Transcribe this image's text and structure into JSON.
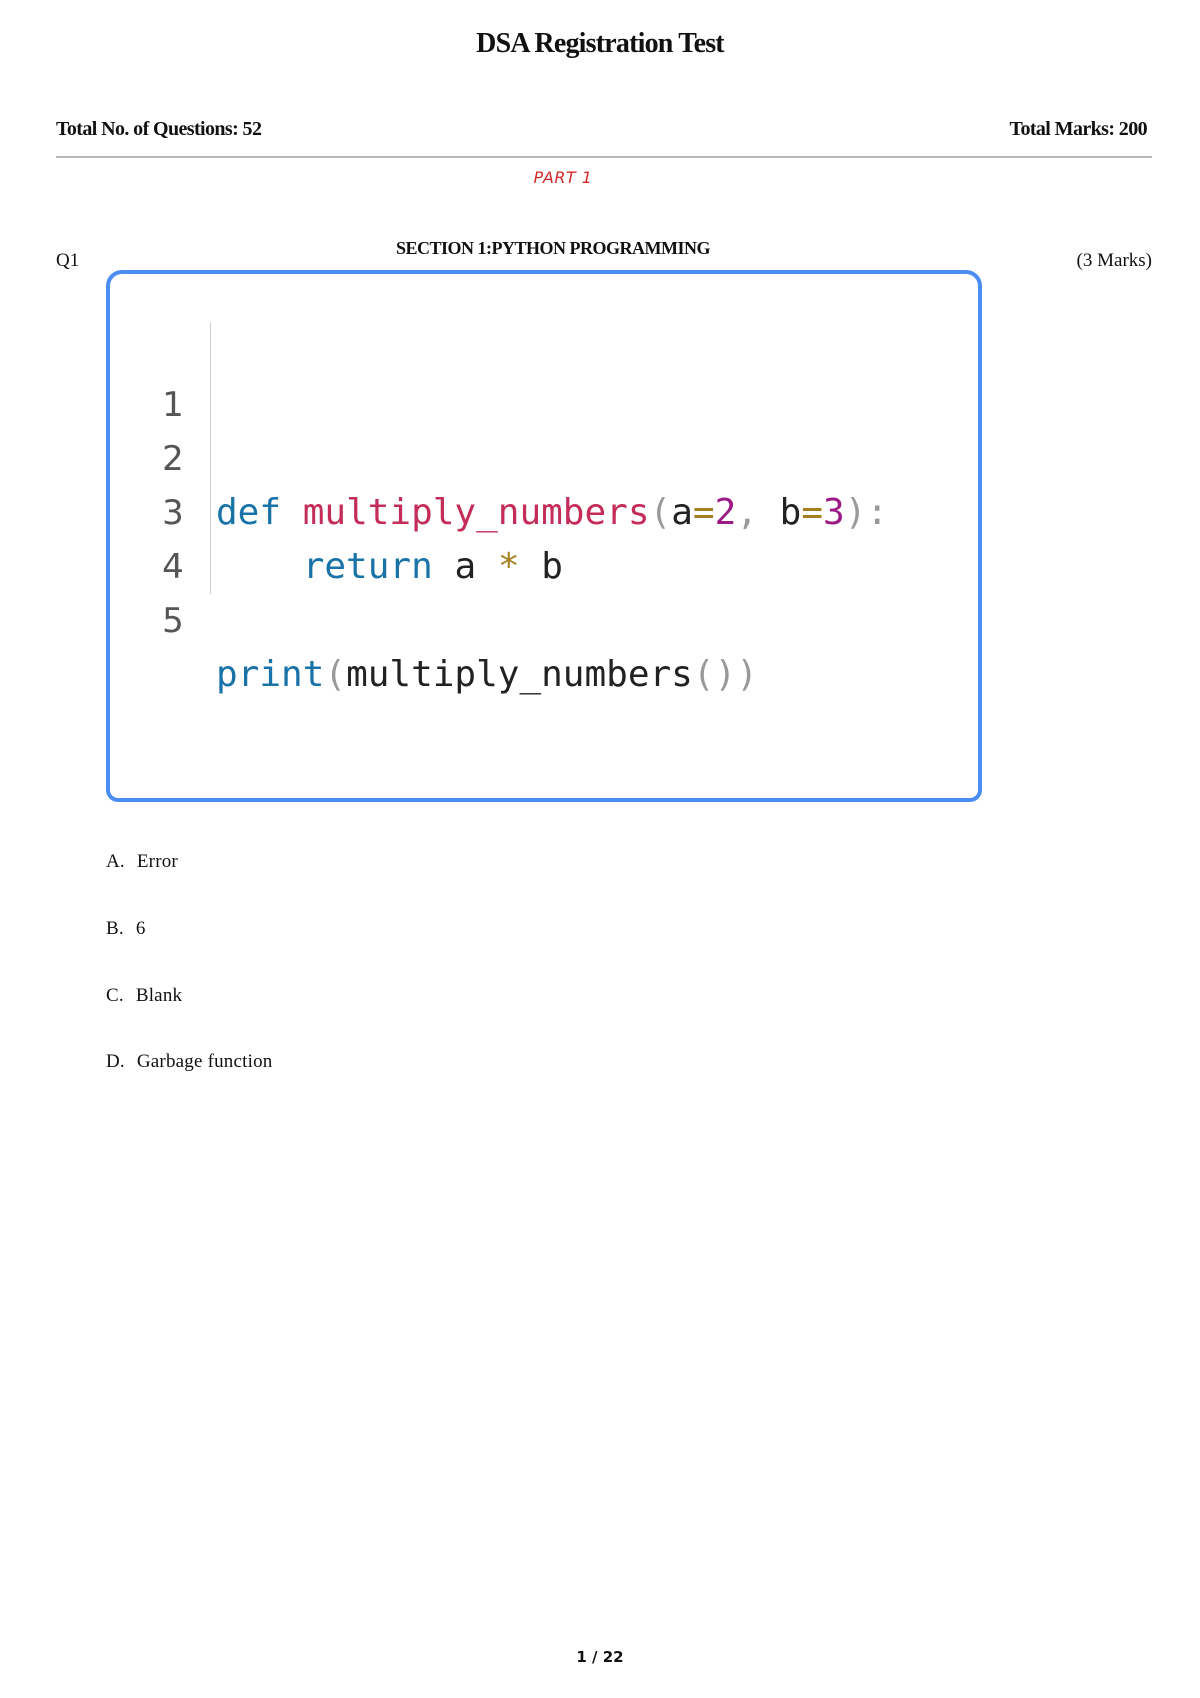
{
  "header": {
    "title": "DSA Registration Test",
    "total_questions": "Total No. of Questions: 52",
    "total_marks": "Total Marks: 200"
  },
  "part": "PART 1",
  "question": {
    "number": "Q1",
    "section": "SECTION 1:PYTHON  PROGRAMMING",
    "marks": "(3 Marks)",
    "code": {
      "line_numbers": [
        "1",
        "2",
        "3",
        "4",
        "5"
      ],
      "line2": {
        "kw": "def",
        "fn": "multiply_numbers",
        "open": "(",
        "a": "a",
        "eq1": "=",
        "v1": "2",
        "comma": ",",
        "b": "b",
        "eq2": "=",
        "v2": "3",
        "close": "):"
      },
      "line3": {
        "kw": "return",
        "a": "a",
        "op": "*",
        "b": "b"
      },
      "line5": {
        "kw": "print",
        "open": "(",
        "fn": "multiply_numbers",
        "parens": "()",
        "close": ")"
      }
    },
    "options": [
      {
        "letter": "A.",
        "text": "Error"
      },
      {
        "letter": "B.",
        "text": "6"
      },
      {
        "letter": "C.",
        "text": "Blank"
      },
      {
        "letter": "D.",
        "text": "Garbage function"
      }
    ]
  },
  "footer": {
    "page": "1 / 22"
  }
}
